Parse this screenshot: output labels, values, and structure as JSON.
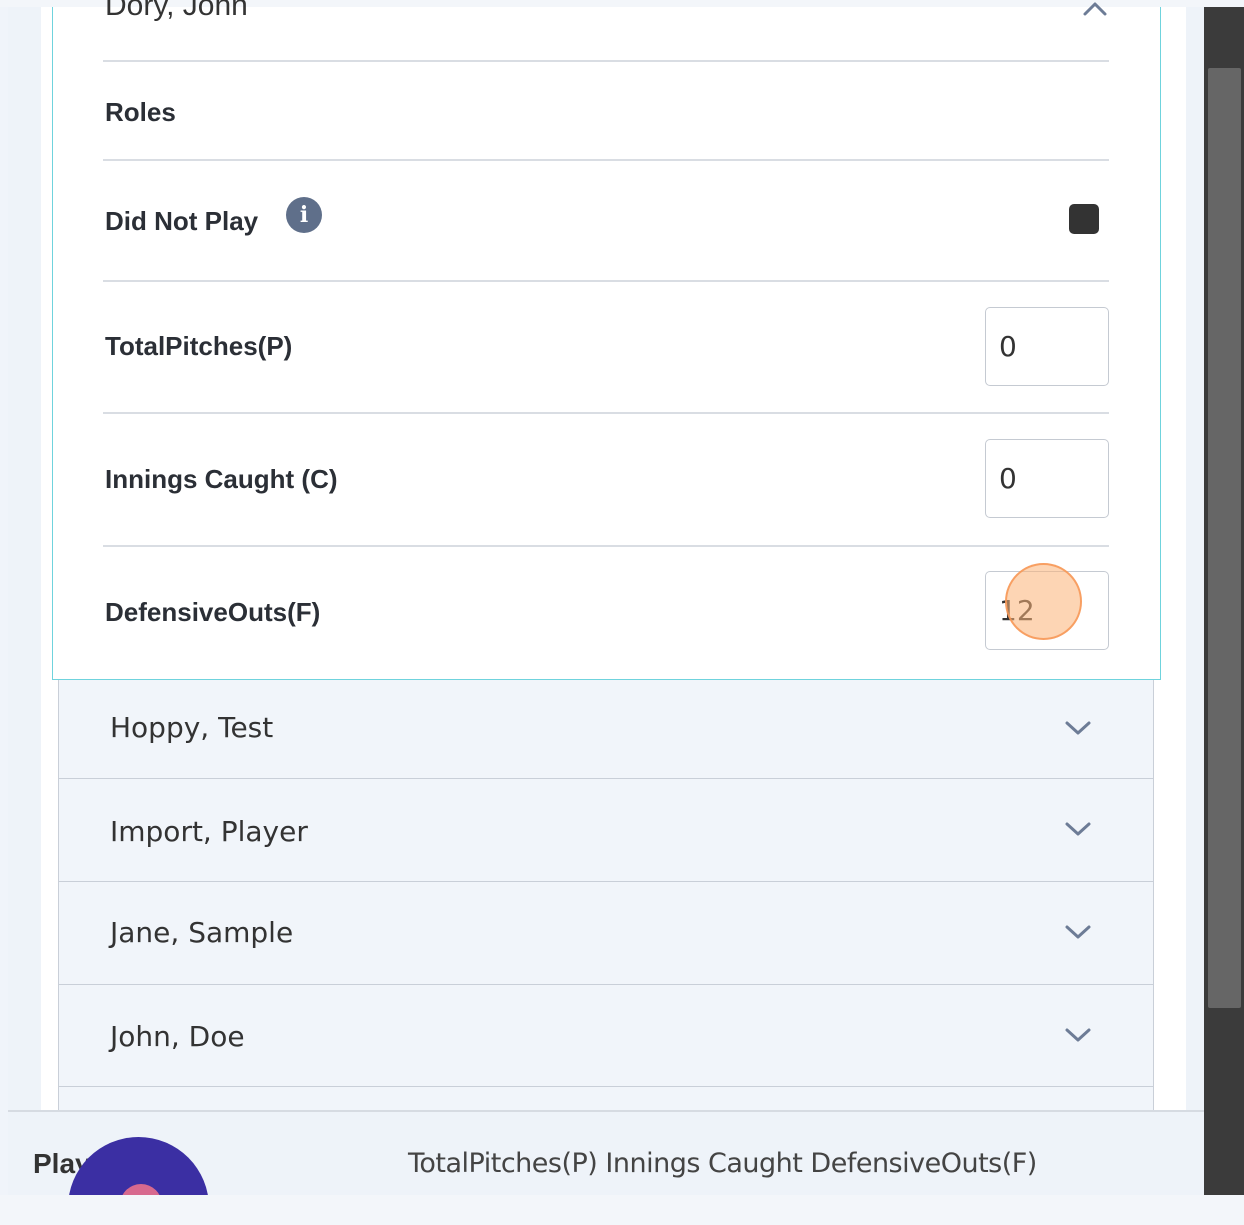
{
  "expanded_player": {
    "name": "Dory, John",
    "roles_label": "Roles",
    "did_not_play_label": "Did Not Play",
    "total_pitches": {
      "label": "TotalPitches(P)",
      "value": "0"
    },
    "innings_caught": {
      "label": "Innings Caught (C)",
      "value": "0"
    },
    "defensive_outs": {
      "label": "DefensiveOuts(F)",
      "value": "12"
    }
  },
  "players": [
    {
      "name": "Hoppy, Test"
    },
    {
      "name": "Import, Player"
    },
    {
      "name": "Jane, Sample"
    },
    {
      "name": "John, Doe"
    }
  ],
  "bottom_bar": {
    "play_label": "Play",
    "columns_text": "TotalPitches(P) Innings Caught DefensiveOuts(F)"
  },
  "icons": {
    "info": "info-icon",
    "collapse": "chevron-up-icon",
    "expand": "chevron-down-icon"
  }
}
